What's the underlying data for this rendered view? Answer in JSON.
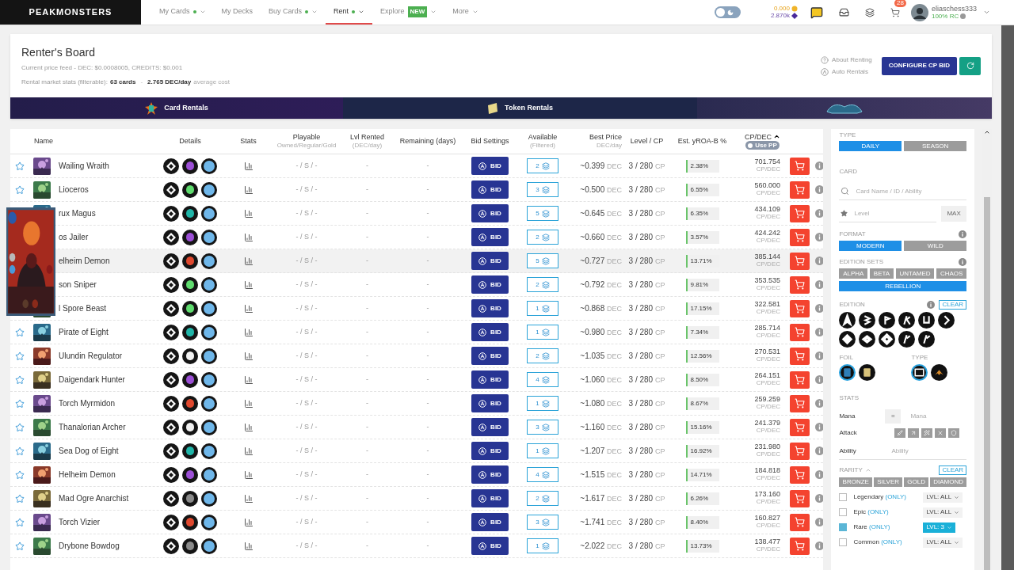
{
  "nav": {
    "logo": "PEAKMONSTERS",
    "items": [
      {
        "label": "My Cards",
        "dot": true,
        "dropdown": true,
        "selected": false
      },
      {
        "label": "My Decks",
        "dot": false,
        "dropdown": false,
        "selected": false
      },
      {
        "label": "Buy Cards",
        "dot": true,
        "dropdown": true,
        "selected": false
      },
      {
        "label": "Rent",
        "dot": true,
        "dropdown": true,
        "selected": true
      },
      {
        "label": "Explore",
        "badge": "NEW",
        "dot": false,
        "dropdown": true,
        "selected": false
      },
      {
        "label": "More",
        "dot": false,
        "dropdown": true,
        "selected": false
      }
    ]
  },
  "account": {
    "theme_toggle": {
      "on": false
    },
    "dec": "0.000",
    "sps": "2.870k",
    "cart_count": "28",
    "username": "eliaschess333",
    "rc": "100% RC"
  },
  "header": {
    "title": "Renter's Board",
    "price_feed": "Current price feed - DEC: $0.0008005, CREDITS: $0.001",
    "stats_prefix": "Rental market stats (filterable):",
    "cards": "63 cards",
    "separator": "-",
    "avg": "2.765 DEC/day",
    "avg_suffix": "average cost",
    "links": [
      "About Renting",
      "Auto Rentals"
    ],
    "configure": "CONFIGURE CP BID"
  },
  "banner": [
    "Card Rentals",
    "Token Rentals"
  ],
  "table": {
    "columns": [
      {
        "label": "Name"
      },
      {
        "label": "Details"
      },
      {
        "label": "Stats"
      },
      {
        "label": "Playable",
        "sub": "Owned/Regular/Gold"
      },
      {
        "label": "Lvl Rented",
        "sub": "(DEC/day)"
      },
      {
        "label": "Remaining (days)"
      },
      {
        "label": "Bid Settings"
      },
      {
        "label": "Available",
        "sub": "(Filtered)"
      },
      {
        "label": "Best Price",
        "sub": "DEC/day"
      },
      {
        "label": "Level / CP"
      },
      {
        "label": "Est. yROA-B %"
      },
      {
        "label": "CP/DEC",
        "sorted": true
      }
    ],
    "use_pp": {
      "label": "Use PP",
      "on": false
    },
    "rows": [
      {
        "name": "Wailing Wraith",
        "color": "#9c4fd6",
        "playable": "- / S / -",
        "lvl_rented": "-",
        "remaining": "-",
        "bid": "BID",
        "available": "2",
        "price": "~0.399",
        "price_unit": "DEC",
        "level_cp": "3 / 280",
        "cp_unit": "CP",
        "yroa": "2.38%",
        "cp_dec": "701.754",
        "cp_dec_unit": "CP/DEC",
        "highlighted": false
      },
      {
        "name": "Lioceros",
        "color": "#5fdc6e",
        "playable": "- / S / -",
        "lvl_rented": "-",
        "remaining": "-",
        "bid": "BID",
        "available": "3",
        "price": "~0.500",
        "price_unit": "DEC",
        "level_cp": "3 / 280",
        "cp_unit": "CP",
        "yroa": "6.55%",
        "cp_dec": "560.000",
        "cp_dec_unit": "CP/DEC",
        "highlighted": false
      },
      {
        "name": "rux Magus",
        "color": "#1fb5a8",
        "playable": "- / S / -",
        "lvl_rented": "-",
        "remaining": "-",
        "bid": "BID",
        "available": "5",
        "price": "~0.645",
        "price_unit": "DEC",
        "level_cp": "3 / 280",
        "cp_unit": "CP",
        "yroa": "6.35%",
        "cp_dec": "434.109",
        "cp_dec_unit": "CP/DEC",
        "highlighted": false
      },
      {
        "name": "os Jailer",
        "color": "#9c4fd6",
        "playable": "- / S / -",
        "lvl_rented": "-",
        "remaining": "-",
        "bid": "BID",
        "available": "2",
        "price": "~0.660",
        "price_unit": "DEC",
        "level_cp": "3 / 280",
        "cp_unit": "CP",
        "yroa": "3.57%",
        "cp_dec": "424.242",
        "cp_dec_unit": "CP/DEC",
        "highlighted": false
      },
      {
        "name": "elheim Demon",
        "color": "#e0482e",
        "playable": "- / S / -",
        "lvl_rented": "-",
        "remaining": "-",
        "bid": "BID",
        "available": "5",
        "price": "~0.727",
        "price_unit": "DEC",
        "level_cp": "3 / 280",
        "cp_unit": "CP",
        "yroa": "13.71%",
        "cp_dec": "385.144",
        "cp_dec_unit": "CP/DEC",
        "highlighted": true
      },
      {
        "name": "son Sniper",
        "color": "#5fdc6e",
        "playable": "- / S / -",
        "lvl_rented": "-",
        "remaining": "-",
        "bid": "BID",
        "available": "2",
        "price": "~0.792",
        "price_unit": "DEC",
        "level_cp": "3 / 280",
        "cp_unit": "CP",
        "yroa": "9.81%",
        "cp_dec": "353.535",
        "cp_dec_unit": "CP/DEC",
        "highlighted": false
      },
      {
        "name": "l Spore Beast",
        "color": "#5fdc6e",
        "playable": "- / S / -",
        "lvl_rented": "-",
        "remaining": "-",
        "bid": "BID",
        "available": "1",
        "price": "~0.868",
        "price_unit": "DEC",
        "level_cp": "3 / 280",
        "cp_unit": "CP",
        "yroa": "17.15%",
        "cp_dec": "322.581",
        "cp_dec_unit": "CP/DEC",
        "highlighted": false
      },
      {
        "name": "Pirate of Eight",
        "color": "#1fb5a8",
        "playable": "- / S / -",
        "lvl_rented": "-",
        "remaining": "-",
        "bid": "BID",
        "available": "1",
        "price": "~0.980",
        "price_unit": "DEC",
        "level_cp": "3 / 280",
        "cp_unit": "CP",
        "yroa": "7.34%",
        "cp_dec": "285.714",
        "cp_dec_unit": "CP/DEC",
        "highlighted": false
      },
      {
        "name": "Ulundin Regulator",
        "color": "#f2f2f2",
        "playable": "- / S / -",
        "lvl_rented": "-",
        "remaining": "-",
        "bid": "BID",
        "available": "2",
        "price": "~1.035",
        "price_unit": "DEC",
        "level_cp": "3 / 280",
        "cp_unit": "CP",
        "yroa": "12.56%",
        "cp_dec": "270.531",
        "cp_dec_unit": "CP/DEC",
        "highlighted": false
      },
      {
        "name": "Daigendark Hunter",
        "color": "#9c4fd6",
        "playable": "- / S / -",
        "lvl_rented": "-",
        "remaining": "-",
        "bid": "BID",
        "available": "4",
        "price": "~1.060",
        "price_unit": "DEC",
        "level_cp": "3 / 280",
        "cp_unit": "CP",
        "yroa": "8.50%",
        "cp_dec": "264.151",
        "cp_dec_unit": "CP/DEC",
        "highlighted": false
      },
      {
        "name": "Torch Myrmidon",
        "color": "#e0482e",
        "playable": "- / S / -",
        "lvl_rented": "-",
        "remaining": "-",
        "bid": "BID",
        "available": "1",
        "price": "~1.080",
        "price_unit": "DEC",
        "level_cp": "3 / 280",
        "cp_unit": "CP",
        "yroa": "8.67%",
        "cp_dec": "259.259",
        "cp_dec_unit": "CP/DEC",
        "highlighted": false
      },
      {
        "name": "Thanalorian Archer",
        "color": "#f2f2f2",
        "playable": "- / S / -",
        "lvl_rented": "-",
        "remaining": "-",
        "bid": "BID",
        "available": "3",
        "price": "~1.160",
        "price_unit": "DEC",
        "level_cp": "3 / 280",
        "cp_unit": "CP",
        "yroa": "15.16%",
        "cp_dec": "241.379",
        "cp_dec_unit": "CP/DEC",
        "highlighted": false
      },
      {
        "name": "Sea Dog of Eight",
        "color": "#1fb5a8",
        "playable": "- / S / -",
        "lvl_rented": "-",
        "remaining": "-",
        "bid": "BID",
        "available": "1",
        "price": "~1.207",
        "price_unit": "DEC",
        "level_cp": "3 / 280",
        "cp_unit": "CP",
        "yroa": "16.92%",
        "cp_dec": "231.980",
        "cp_dec_unit": "CP/DEC",
        "highlighted": false
      },
      {
        "name": "Helheim Demon",
        "color": "#9c4fd6",
        "playable": "- / S / -",
        "lvl_rented": "-",
        "remaining": "-",
        "bid": "BID",
        "available": "4",
        "price": "~1.515",
        "price_unit": "DEC",
        "level_cp": "3 / 280",
        "cp_unit": "CP",
        "yroa": "14.71%",
        "cp_dec": "184.818",
        "cp_dec_unit": "CP/DEC",
        "highlighted": false
      },
      {
        "name": "Mad Ogre Anarchist",
        "color": "#8a8a8a",
        "playable": "- / S / -",
        "lvl_rented": "-",
        "remaining": "-",
        "bid": "BID",
        "available": "2",
        "price": "~1.617",
        "price_unit": "DEC",
        "level_cp": "3 / 280",
        "cp_unit": "CP",
        "yroa": "6.26%",
        "cp_dec": "173.160",
        "cp_dec_unit": "CP/DEC",
        "highlighted": false
      },
      {
        "name": "Torch Vizier",
        "color": "#e0482e",
        "playable": "- / S / -",
        "lvl_rented": "-",
        "remaining": "-",
        "bid": "BID",
        "available": "3",
        "price": "~1.741",
        "price_unit": "DEC",
        "level_cp": "3 / 280",
        "cp_unit": "CP",
        "yroa": "8.40%",
        "cp_dec": "160.827",
        "cp_dec_unit": "CP/DEC",
        "highlighted": false
      },
      {
        "name": "Drybone Bowdog",
        "color": "#8a8a8a",
        "playable": "- / S / -",
        "lvl_rented": "-",
        "remaining": "-",
        "bid": "BID",
        "available": "1",
        "price": "~2.022",
        "price_unit": "DEC",
        "level_cp": "3 / 280",
        "cp_unit": "CP",
        "yroa": "13.73%",
        "cp_dec": "138.477",
        "cp_dec_unit": "CP/DEC",
        "highlighted": false
      }
    ]
  },
  "filters": {
    "type": {
      "label": "TYPE",
      "options": [
        {
          "label": "DAILY",
          "selected": true
        },
        {
          "label": "SEASON",
          "selected": false
        }
      ]
    },
    "card": {
      "label": "CARD",
      "search_placeholder": "Card Name / ID / Ability",
      "level_placeholder": "Level",
      "max": "MAX"
    },
    "format": {
      "label": "FORMAT",
      "options": [
        {
          "label": "MODERN",
          "selected": true
        },
        {
          "label": "WILD",
          "selected": false
        }
      ]
    },
    "edition_sets": {
      "label": "EDITION SETS",
      "options": [
        {
          "label": "ALPHA",
          "selected": false
        },
        {
          "label": "BETA",
          "selected": false
        },
        {
          "label": "UNTAMED",
          "selected": false
        },
        {
          "label": "CHAOS",
          "selected": false
        },
        {
          "label": "REBELLION",
          "selected": true
        }
      ]
    },
    "edition": {
      "label": "EDITION",
      "clear": "CLEAR"
    },
    "foil": {
      "label": "FOIL",
      "options": [
        {
          "kind": "regular",
          "selected": true
        },
        {
          "kind": "gold",
          "selected": false
        }
      ]
    },
    "card_type": {
      "label": "TYPE",
      "options": [
        {
          "kind": "monster",
          "selected": true
        },
        {
          "kind": "summoner",
          "selected": false
        }
      ]
    },
    "stats": {
      "label": "STATS",
      "mana_label": "Mana",
      "mana_op": "=",
      "mana_placeholder": "Mana",
      "attack_label": "Attack",
      "ability_label": "Ability",
      "ability_placeholder": "Ability"
    },
    "rarity": {
      "label": "RARITY",
      "clear": "CLEAR",
      "tiers": [
        "BRONZE",
        "SILVER",
        "GOLD",
        "DIAMOND"
      ],
      "items": [
        {
          "label": "Legendary",
          "only": "(ONLY)",
          "checked": false,
          "level": "LVL: ALL"
        },
        {
          "label": "Epic",
          "only": "(ONLY)",
          "checked": false,
          "level": "LVL: ALL"
        },
        {
          "label": "Rare",
          "only": "(ONLY)",
          "checked": true,
          "level": "LVL: 3"
        },
        {
          "label": "Common",
          "only": "(ONLY)",
          "checked": false,
          "level": "LVL: ALL"
        }
      ]
    }
  }
}
